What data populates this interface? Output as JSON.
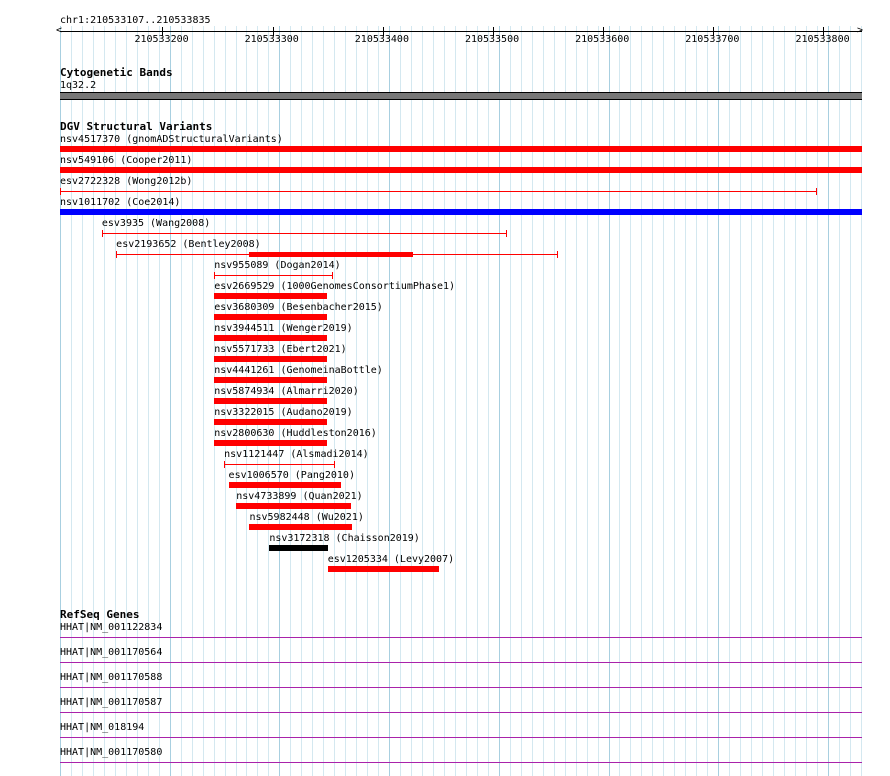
{
  "location": "chr1:210533107..210533835",
  "ruler": {
    "ticks": [
      "210533200",
      "210533300",
      "210533400",
      "210533500",
      "210533600",
      "210533700",
      "210533800"
    ],
    "range": [
      210533107,
      210533835
    ]
  },
  "tracks": {
    "cytoband": {
      "title": "Cytogenetic Bands",
      "band": "1q32.2",
      "color": "#777777"
    },
    "dgv": {
      "title": "DGV Structural Variants",
      "features": [
        {
          "label": "nsv4517370 (gnomADStructuralVariants)",
          "style": "full",
          "color": "#ff0000",
          "start": 210533107,
          "end": 210533835
        },
        {
          "label": "nsv549106 (Cooper2011)",
          "style": "full",
          "color": "#ff0000",
          "start": 210533107,
          "end": 210533835
        },
        {
          "label": "esv2722328 (Wong2012b)",
          "style": "thin",
          "color": "#ff0000",
          "start": 210533107,
          "end": 210533793
        },
        {
          "label": "nsv1011702 (Coe2014)",
          "style": "full",
          "color": "#0000ff",
          "start": 210533107,
          "end": 210533835
        },
        {
          "label": "esv3935 (Wang2008)",
          "style": "thin",
          "color": "#ff0000",
          "start": 210533145,
          "end": 210533512
        },
        {
          "label": "esv2193652 (Bentley2008)",
          "style": "thinwithbar",
          "color": "#ff0000",
          "start": 210533158,
          "end": 210533558,
          "barStart": 210533279,
          "barEnd": 210533427
        },
        {
          "label": "nsv955089 (Dogan2014)",
          "style": "thin",
          "color": "#ff0000",
          "start": 210533247,
          "end": 210533354
        },
        {
          "label": "esv2669529 (1000GenomesConsortiumPhase1)",
          "style": "full",
          "color": "#ff0000",
          "start": 210533247,
          "end": 210533349
        },
        {
          "label": "esv3680309 (Besenbacher2015)",
          "style": "full",
          "color": "#ff0000",
          "start": 210533247,
          "end": 210533349
        },
        {
          "label": "nsv3944511 (Wenger2019)",
          "style": "full",
          "color": "#ff0000",
          "start": 210533247,
          "end": 210533349
        },
        {
          "label": "nsv5571733 (Ebert2021)",
          "style": "full",
          "color": "#ff0000",
          "start": 210533247,
          "end": 210533349
        },
        {
          "label": "nsv4441261 (GenomeinaBottle)",
          "style": "full",
          "color": "#ff0000",
          "start": 210533247,
          "end": 210533349
        },
        {
          "label": "nsv5874934 (Almarri2020)",
          "style": "full",
          "color": "#ff0000",
          "start": 210533247,
          "end": 210533349
        },
        {
          "label": "nsv3322015 (Audano2019)",
          "style": "full",
          "color": "#ff0000",
          "start": 210533247,
          "end": 210533349
        },
        {
          "label": "nsv2800630 (Huddleston2016)",
          "style": "full",
          "color": "#ff0000",
          "start": 210533247,
          "end": 210533349
        },
        {
          "label": "nsv1121447 (Alsmadi2014)",
          "style": "thin",
          "color": "#ff0000",
          "start": 210533256,
          "end": 210533356
        },
        {
          "label": "esv1006570 (Pang2010)",
          "style": "full",
          "color": "#ff0000",
          "start": 210533260,
          "end": 210533362
        },
        {
          "label": "nsv4733899 (Quan2021)",
          "style": "full",
          "color": "#ff0000",
          "start": 210533267,
          "end": 210533371
        },
        {
          "label": "nsv5982448 (Wu2021)",
          "style": "full",
          "color": "#ff0000",
          "start": 210533279,
          "end": 210533372
        },
        {
          "label": "nsv3172318 (Chaisson2019)",
          "style": "full",
          "color": "#000000",
          "start": 210533297,
          "end": 210533350
        },
        {
          "label": "esv1205334 (Levy2007)",
          "style": "full",
          "color": "#ff0000",
          "start": 210533350,
          "end": 210533451
        }
      ]
    },
    "refseq": {
      "title": "RefSeq Genes",
      "color": "#aa22aa",
      "features": [
        {
          "label": "HHAT|NM_001122834"
        },
        {
          "label": "HHAT|NM_001170564"
        },
        {
          "label": "HHAT|NM_001170588"
        },
        {
          "label": "HHAT|NM_001170587"
        },
        {
          "label": "HHAT|NM_018194"
        },
        {
          "label": "HHAT|NM_001170580"
        }
      ]
    }
  }
}
